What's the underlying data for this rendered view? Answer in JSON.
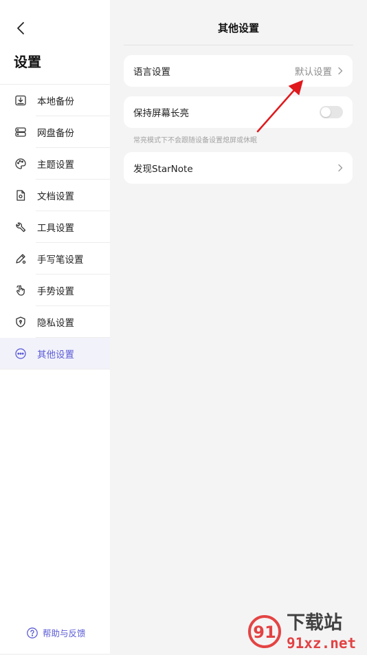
{
  "sidebar": {
    "back_icon": "chevron-left-icon",
    "title": "设置",
    "items": [
      {
        "label": "本地备份",
        "icon": "local-backup-icon"
      },
      {
        "label": "网盘备份",
        "icon": "cloud-drive-icon"
      },
      {
        "label": "主题设置",
        "icon": "palette-icon"
      },
      {
        "label": "文档设置",
        "icon": "document-gear-icon"
      },
      {
        "label": "工具设置",
        "icon": "wrench-icon"
      },
      {
        "label": "手写笔设置",
        "icon": "pen-gear-icon"
      },
      {
        "label": "手势设置",
        "icon": "hand-gesture-icon"
      },
      {
        "label": "隐私设置",
        "icon": "shield-icon"
      },
      {
        "label": "其他设置",
        "icon": "more-dots-icon",
        "active": true
      }
    ],
    "help_label": "帮助与反馈",
    "help_icon": "question-circle-icon"
  },
  "main": {
    "title": "其他设置",
    "language": {
      "label": "语言设置",
      "value": "默认设置"
    },
    "keep_screen_on": {
      "label": "保持屏幕长亮",
      "enabled": false,
      "hint": "常亮模式下不会跟随设备设置熄屏或休眠"
    },
    "discover": {
      "label": "发现StarNote"
    }
  },
  "colors": {
    "accent": "#5b5bd6",
    "background": "#f4f4f5",
    "annotation_arrow": "#e0191c",
    "watermark_red": "#e02424"
  },
  "watermark": {
    "top_text": "下载站",
    "bottom_text": "91xz.net",
    "logo_numeral": "91"
  }
}
